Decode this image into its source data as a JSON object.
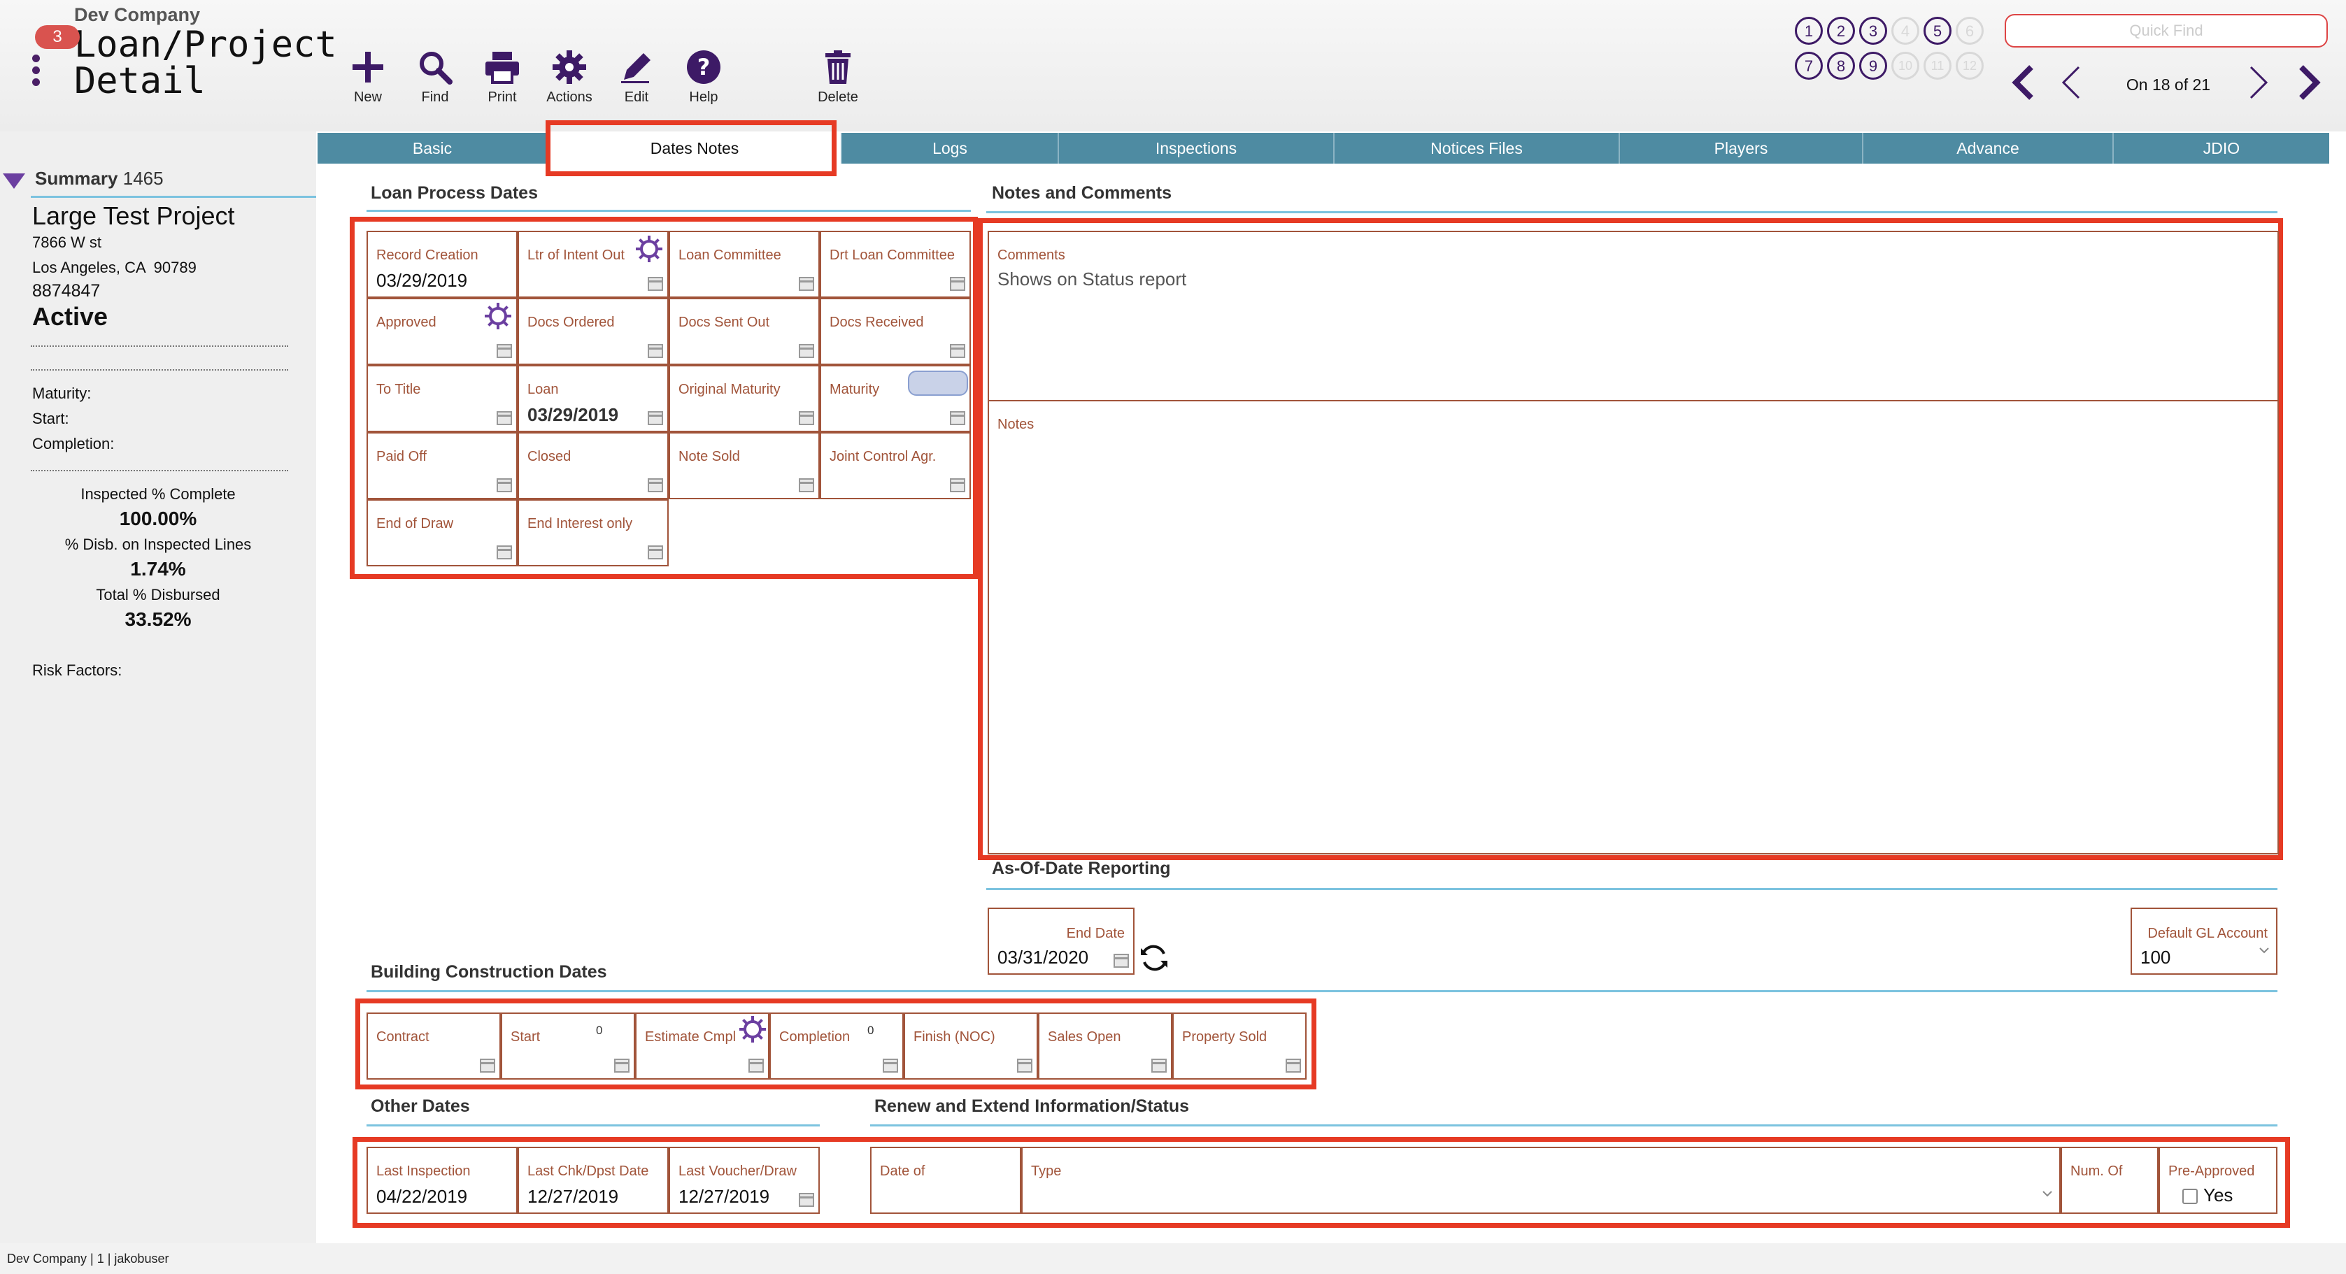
{
  "app": {
    "company": "Dev Company",
    "badge": "3",
    "title": "Loan/Project Detail"
  },
  "toolbar": {
    "new": "New",
    "find": "Find",
    "print": "Print",
    "actions": "Actions",
    "edit": "Edit",
    "help": "Help",
    "delete": "Delete"
  },
  "records": {
    "row1": [
      "1",
      "2",
      "3",
      "4",
      "5",
      "6"
    ],
    "row2": [
      "7",
      "8",
      "9",
      "10",
      "11",
      "12"
    ],
    "quick_find_placeholder": "Quick Find",
    "position": "On 18 of 21"
  },
  "tabs": [
    "Basic",
    "Dates Notes",
    "Logs",
    "Inspections",
    "Notices Files",
    "Players",
    "Advance",
    "JDIO"
  ],
  "active_tab": "Dates Notes",
  "summary": {
    "label": "Summary",
    "number": "1465",
    "project_name": "Large Test Project",
    "address1": "7866 W st",
    "address2": "Los Angeles, CA  90789",
    "loan_no": "8874847",
    "status": "Active",
    "maturity_label": "Maturity:",
    "start_label": "Start:",
    "completion_label": "Completion:",
    "inspected_label": "Inspected % Complete",
    "inspected_value": "100.00%",
    "disb_inspected_label": "% Disb. on Inspected Lines",
    "disb_inspected_value": "1.74%",
    "total_disb_label": "Total % Disbursed",
    "total_disb_value": "33.52%",
    "risk_label": "Risk Factors:"
  },
  "loan_process": {
    "title": "Loan Process Dates",
    "fields": [
      {
        "label": "Record Creation",
        "value": "03/29/2019"
      },
      {
        "label": "Ltr of Intent Out",
        "value": ""
      },
      {
        "label": "Loan Committee",
        "value": ""
      },
      {
        "label": "Drt Loan Committee",
        "value": ""
      },
      {
        "label": "Approved",
        "value": ""
      },
      {
        "label": "Docs Ordered",
        "value": ""
      },
      {
        "label": "Docs Sent Out",
        "value": ""
      },
      {
        "label": "Docs Received",
        "value": ""
      },
      {
        "label": "To Title",
        "value": ""
      },
      {
        "label": "Loan",
        "value": "03/29/2019"
      },
      {
        "label": "Original Maturity",
        "value": ""
      },
      {
        "label": "Maturity",
        "value": ""
      },
      {
        "label": "Paid Off",
        "value": ""
      },
      {
        "label": "Closed",
        "value": ""
      },
      {
        "label": "Note Sold",
        "value": ""
      },
      {
        "label": "Joint Control Agr.",
        "value": ""
      },
      {
        "label": "End of Draw",
        "value": ""
      },
      {
        "label": "End Interest only",
        "value": ""
      }
    ]
  },
  "notes": {
    "title": "Notes and Comments",
    "comments_label": "Comments",
    "comments_value": "Shows on Status report",
    "notes_label": "Notes"
  },
  "asofdate": {
    "title": "As-Of-Date Reporting",
    "end_date_label": "End Date",
    "end_date_value": "03/31/2020",
    "gl_label": "Default GL Account",
    "gl_value": "100"
  },
  "construction": {
    "title": "Building Construction Dates",
    "fields": [
      {
        "label": "Contract",
        "value": ""
      },
      {
        "label": "Start",
        "value": ""
      },
      {
        "label": "Estimate Cmpl",
        "value": ""
      },
      {
        "label": "Completion",
        "value": ""
      },
      {
        "label": "Finish (NOC)",
        "value": ""
      },
      {
        "label": "Sales Open",
        "value": ""
      },
      {
        "label": "Property Sold",
        "value": ""
      }
    ],
    "start_count": "0",
    "completion_count": "0"
  },
  "other_dates": {
    "title": "Other Dates",
    "fields": [
      {
        "label": "Last Inspection",
        "value": "04/22/2019"
      },
      {
        "label": "Last Chk/Dpst Date",
        "value": "12/27/2019"
      },
      {
        "label": "Last Voucher/Draw",
        "value": "12/27/2019"
      }
    ]
  },
  "renew": {
    "title": "Renew and Extend Information/Status",
    "date_of_label": "Date of",
    "type_label": "Type",
    "num_of_label": "Num. Of",
    "preapproved_label": "Pre-Approved",
    "yes_label": "Yes"
  },
  "footer": "Dev Company | 1 | jakobuser",
  "colors": {
    "accent_purple": "#3d1a66",
    "tab_bar": "#4e8ba2",
    "highlight_red": "#e63a24",
    "field_label": "#a1543a",
    "section_rule": "#7cc3df"
  }
}
